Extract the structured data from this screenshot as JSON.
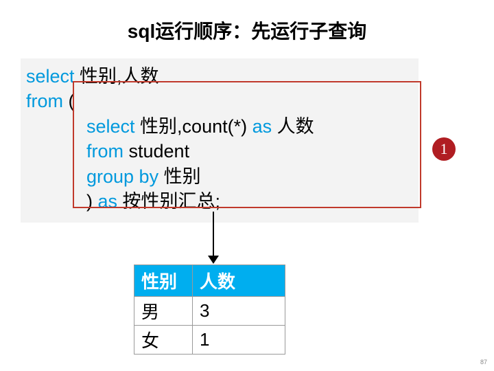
{
  "title": "sql运行顺序：先运行子查询",
  "code": {
    "line1": {
      "kw1": "select",
      "rest1": " 性别,人数"
    },
    "line2": {
      "kw1": "from",
      "rest1": " ("
    },
    "line3": {
      "kw1": "select",
      "rest1": " 性别,count(*) ",
      "kw2": "as",
      "rest2": " 人数"
    },
    "line4": {
      "kw1": "from",
      "rest1": " student"
    },
    "line5": {
      "kw1": "group by",
      "rest1": " 性别"
    },
    "line6": {
      "rest1": ") ",
      "kw1": "as",
      "rest2": " 按性别汇总;"
    }
  },
  "badge": "1",
  "table": {
    "headers": [
      "性别",
      "人数"
    ],
    "rows": [
      [
        "男",
        "3"
      ],
      [
        "女",
        "1"
      ]
    ]
  },
  "pageNumber": "87"
}
